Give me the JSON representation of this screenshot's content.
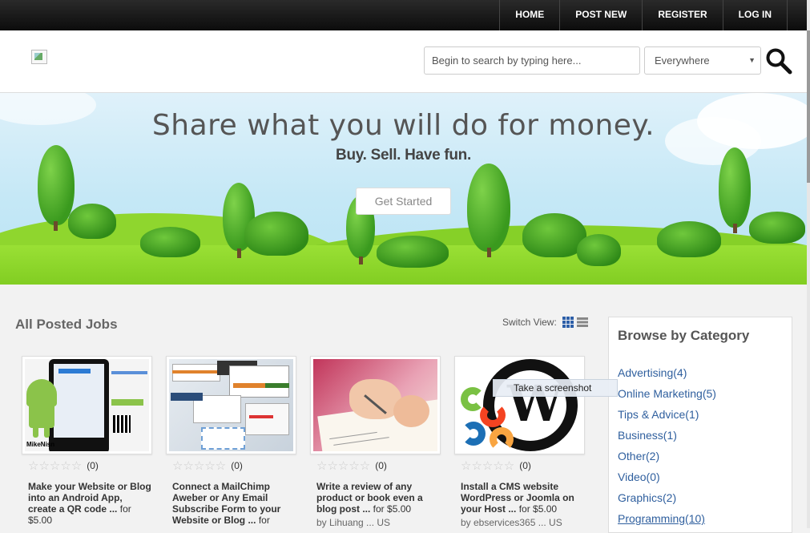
{
  "nav": {
    "home": "HOME",
    "post_new": "POST NEW",
    "register": "REGISTER",
    "login": "LOG IN"
  },
  "search": {
    "placeholder": "Begin to search by typing here...",
    "scope": "Everywhere"
  },
  "hero": {
    "title": "Share what you will do for money.",
    "subtitle": "Buy. Sell. Have fun.",
    "cta": "Get Started"
  },
  "jobs": {
    "title": "All Posted Jobs",
    "switch_label": "Switch View:",
    "items": [
      {
        "title": "Make your Website or Blog into an Android App, create a QR code ...",
        "for": "for",
        "price": "$5.00",
        "rating": "(0)",
        "thumb_caption": "MikeNisn",
        "by": ""
      },
      {
        "title": "Connect a MailChimp Aweber or Any Email Subscribe Form to your Website or Blog ...",
        "for": "for",
        "price": "",
        "rating": "(0)",
        "thumb_caption": "",
        "by": ""
      },
      {
        "title": "Write a review of any product or book even a blog post ...",
        "for": "for",
        "price": "$5.00",
        "rating": "(0)",
        "thumb_caption": "",
        "by": "by Lihuang ... US"
      },
      {
        "title": "Install a CMS website WordPress or Joomla on your Host ...",
        "for": "for",
        "price": "$5.00",
        "rating": "(0)",
        "thumb_caption": "",
        "by": "by ebservices365 ... US"
      }
    ]
  },
  "sidebar": {
    "title": "Browse by Category",
    "categories": [
      {
        "label": "Advertising(4)"
      },
      {
        "label": "Online Marketing(5)"
      },
      {
        "label": "Tips & Advice(1)"
      },
      {
        "label": "Business(1)"
      },
      {
        "label": "Other(2)"
      },
      {
        "label": "Video(0)"
      },
      {
        "label": "Graphics(2)"
      },
      {
        "label": "Programming(10)"
      }
    ]
  },
  "tooltip": "Take a screenshot"
}
